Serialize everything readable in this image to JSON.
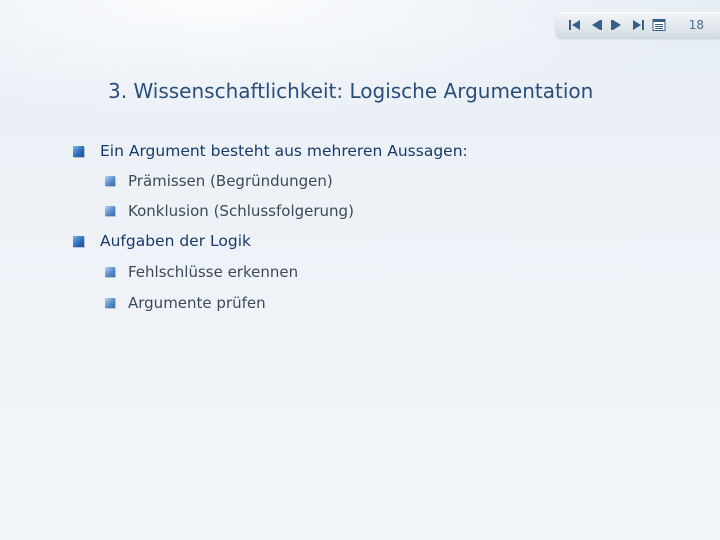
{
  "page_number": "18",
  "nav": {
    "buttons": [
      {
        "name": "first-slide-icon"
      },
      {
        "name": "previous-slide-icon"
      },
      {
        "name": "next-slide-icon"
      },
      {
        "name": "last-slide-icon"
      },
      {
        "name": "slide-list-icon"
      }
    ]
  },
  "slide": {
    "title": "3. Wissenschaftlichkeit: Logische Argumentation",
    "bullets": [
      {
        "text": "Ein Argument besteht aus mehreren Aussagen:",
        "sub": [
          "Prämissen (Begründungen)",
          "Konklusion (Schlussfolgerung)"
        ]
      },
      {
        "text": "Aufgaben der Logik",
        "sub": [
          "Fehlschlüsse erkennen",
          "Argumente prüfen"
        ]
      }
    ]
  },
  "colors": {
    "accent": "#2e6fbf",
    "title": "#2a4e7a",
    "background": "#eef2f7"
  }
}
